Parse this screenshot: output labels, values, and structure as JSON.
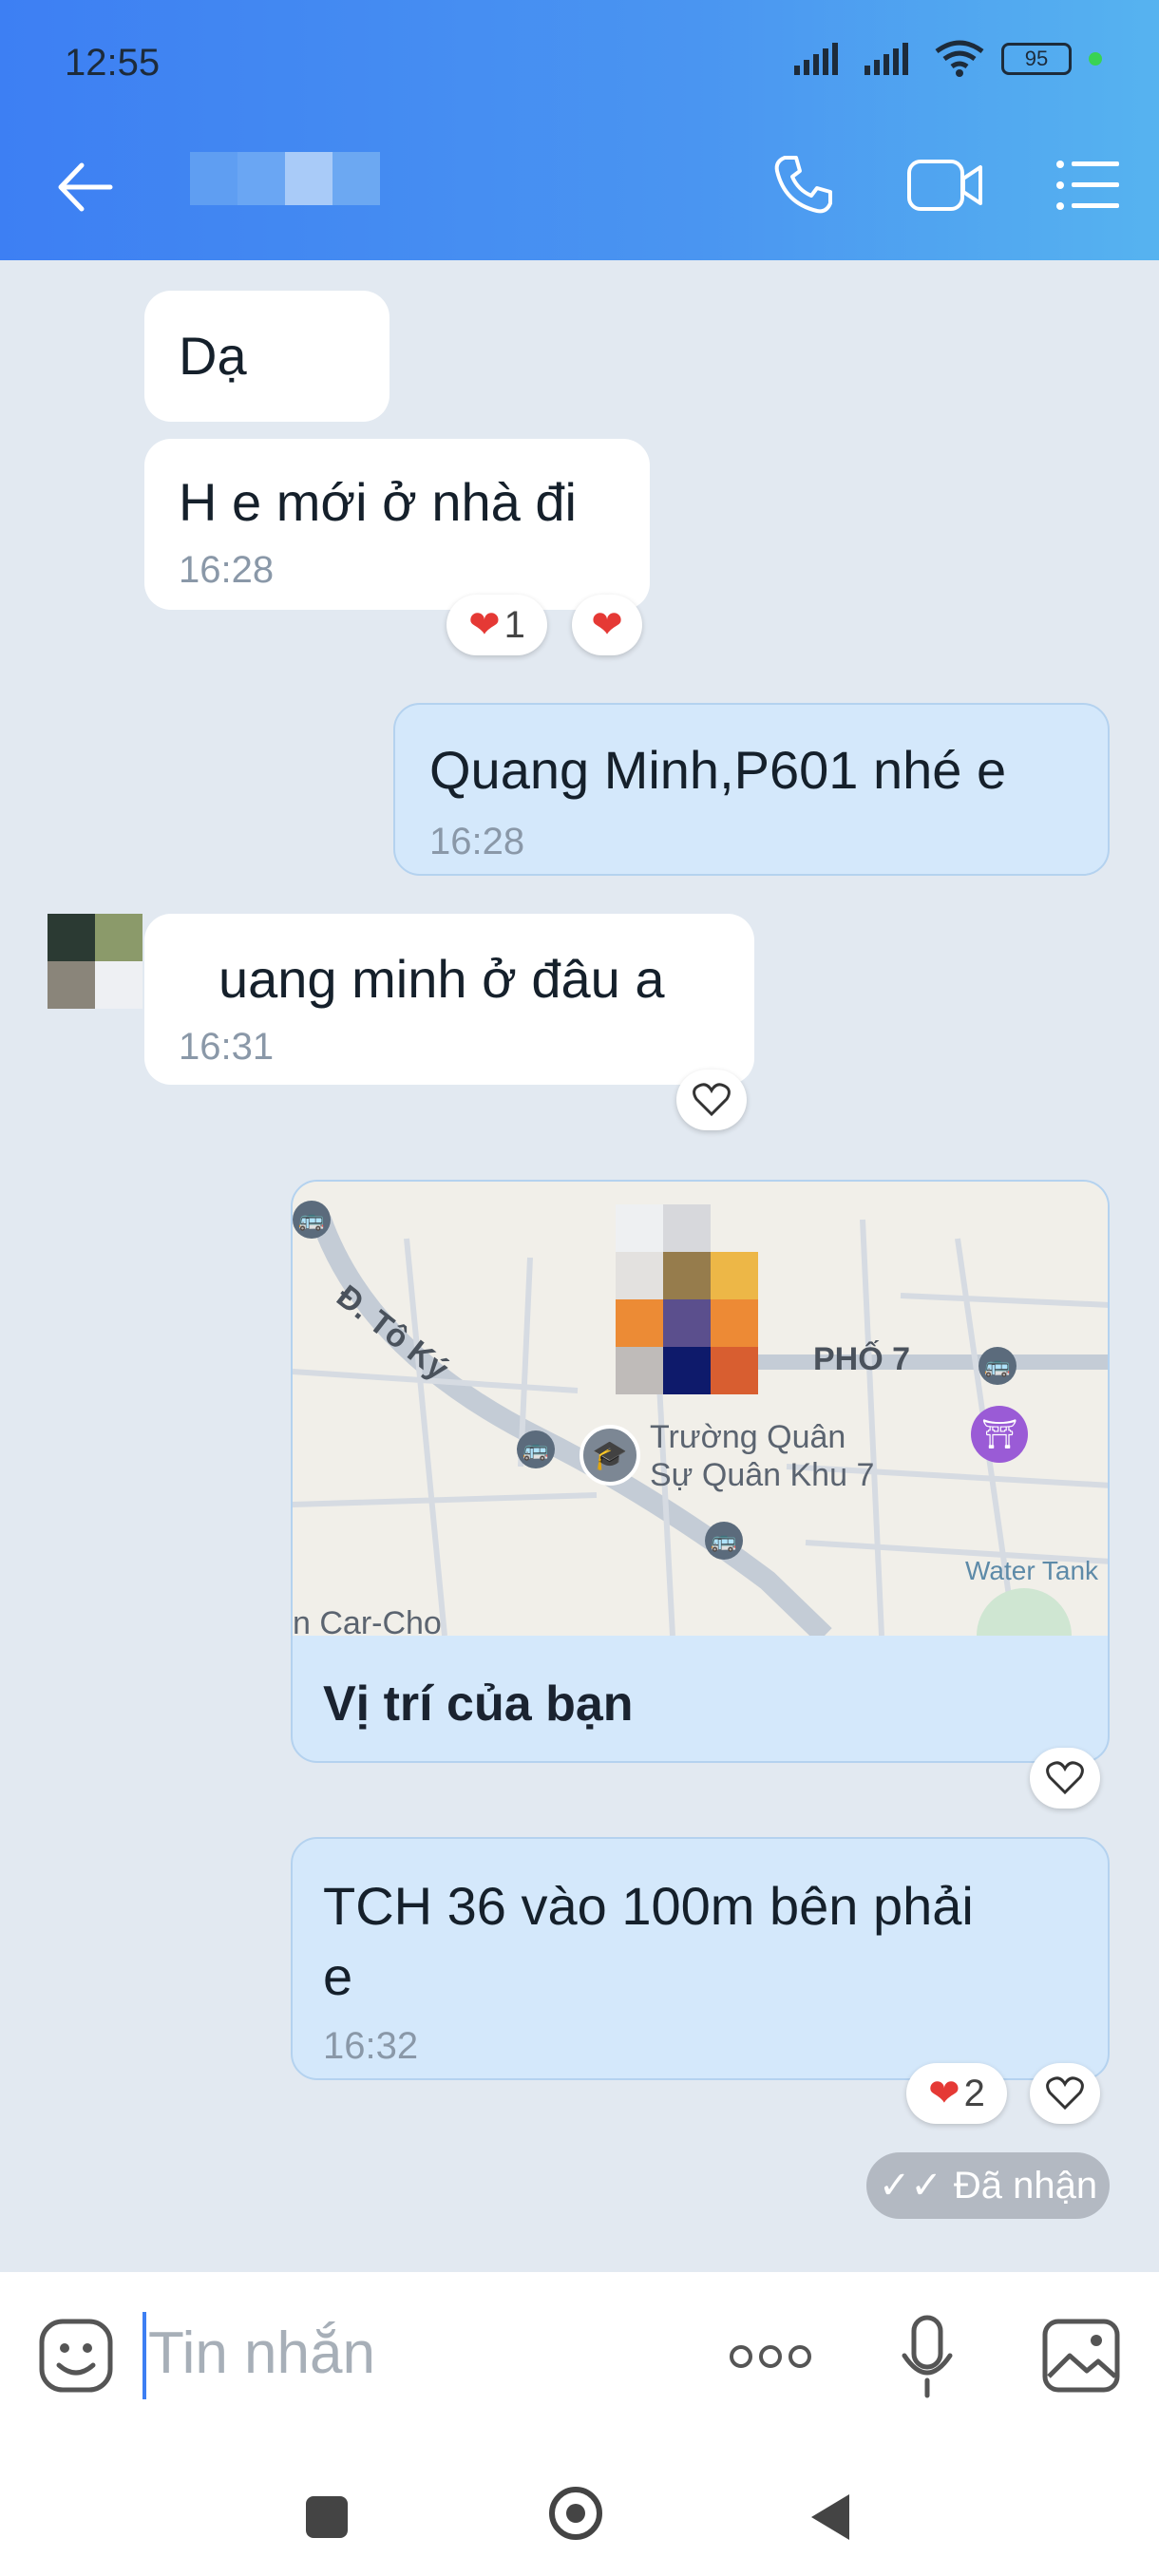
{
  "status_bar": {
    "time": "12:55",
    "battery": "95"
  },
  "header": {
    "back_icon": "arrow-left-icon",
    "call_icon": "phone-icon",
    "video_icon": "video-camera-icon",
    "menu_icon": "list-menu-icon",
    "bg_start": "#3d7ff3",
    "bg_end": "#56b3f0"
  },
  "messages": [
    {
      "direction": "in",
      "text": "Dạ"
    },
    {
      "direction": "in",
      "text": "H e mới ở nhà đi",
      "time": "16:28",
      "reaction_count": "1"
    },
    {
      "direction": "out",
      "text": "Quang Minh,P601 nhé e",
      "time": "16:28"
    },
    {
      "direction": "in",
      "text": "uang minh ở đâu a",
      "time": "16:31"
    },
    {
      "direction": "out",
      "type": "location",
      "caption": "Vị trí của bạn",
      "map_labels": {
        "street": "Đ. Tô Ký",
        "area": "PHỐ 7",
        "poi_line1": "Trường Quân",
        "poi_line2": "Sự Quân Khu 7",
        "water": "Water Tank",
        "bottom": "n Car-Cho"
      }
    },
    {
      "direction": "out",
      "text_line1": "TCH 36 vào 100m bên phải",
      "text_line2": "e",
      "time": "16:32",
      "reaction_count": "2"
    }
  ],
  "delivery_status": "Đã nhận",
  "composer": {
    "placeholder": "Tin nhắn",
    "more_icon": "more-dots-icon",
    "mic_icon": "microphone-icon",
    "image_icon": "image-icon",
    "emoji_icon": "emoji-icon"
  },
  "colors": {
    "incoming": "#ffffff",
    "outgoing": "#d4e8fb",
    "chat_bg": "#e2e9f1"
  }
}
